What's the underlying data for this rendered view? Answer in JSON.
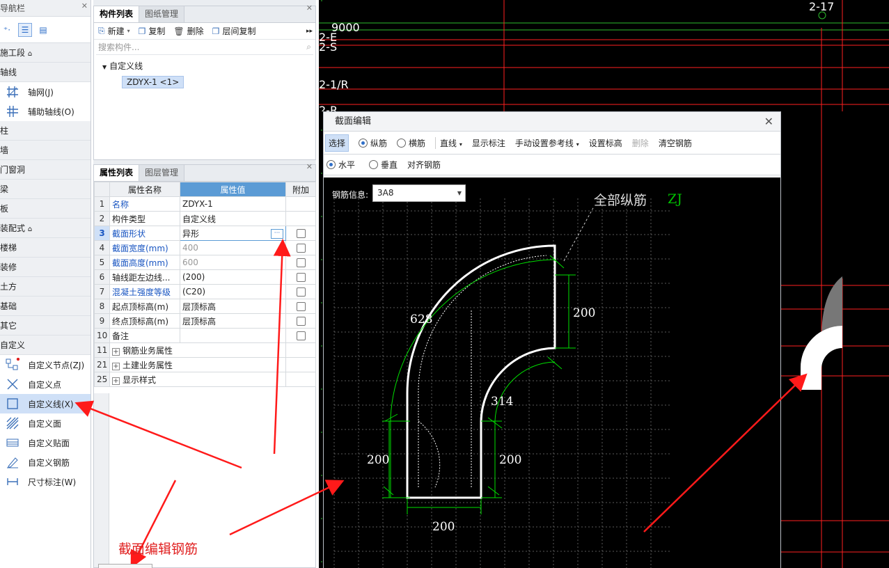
{
  "nav": {
    "title": "导航栏",
    "categories": {
      "c1": "施工段",
      "c2": "轴线",
      "c3": "柱",
      "c4": "墙",
      "c5": "门窗洞",
      "c6": "梁",
      "c7": "板",
      "c8": "装配式",
      "c9": "楼梯",
      "c10": "装修",
      "c11": "土方",
      "c12": "基础",
      "c13": "其它",
      "c14": "自定义"
    },
    "axis_items": {
      "grid": "轴网(J)",
      "aux": "辅助轴线(O)"
    },
    "custom_items": {
      "node": "自定义节点(ZJ)",
      "point": "自定义点",
      "line": "自定义线(X)",
      "face": "自定义面",
      "patch": "自定义贴面",
      "rebar": "自定义钢筋",
      "dim": "尺寸标注(W)"
    }
  },
  "component_panel": {
    "tab1": "构件列表",
    "tab2": "图纸管理",
    "toolbar": {
      "new": "新建",
      "copy": "复制",
      "delete": "删除",
      "floor_copy": "层间复制"
    },
    "search_placeholder": "搜索构件...",
    "tree_root": "自定义线",
    "tree_leaf": "ZDYX-1 <1>"
  },
  "property_panel": {
    "tab1": "属性列表",
    "tab2": "图层管理",
    "headers": {
      "name": "属性名称",
      "value": "属性值",
      "extra": "附加"
    },
    "rows": {
      "r1": {
        "n": "1",
        "name": "名称",
        "value": "ZDYX-1"
      },
      "r2": {
        "n": "2",
        "name": "构件类型",
        "value": "自定义线"
      },
      "r3": {
        "n": "3",
        "name": "截面形状",
        "value": "异形"
      },
      "r4": {
        "n": "4",
        "name": "截面宽度(mm)",
        "value": "400"
      },
      "r5": {
        "n": "5",
        "name": "截面高度(mm)",
        "value": "600"
      },
      "r6": {
        "n": "6",
        "name": "轴线距左边线...",
        "value": "(200)"
      },
      "r7": {
        "n": "7",
        "name": "混凝土强度等级",
        "value": "(C20)"
      },
      "r8": {
        "n": "8",
        "name": "起点顶标高(m)",
        "value": "层顶标高"
      },
      "r9": {
        "n": "9",
        "name": "终点顶标高(m)",
        "value": "层顶标高"
      },
      "r10": {
        "n": "10",
        "name": "备注",
        "value": ""
      },
      "r11": {
        "n": "11",
        "name": "钢筋业务属性"
      },
      "r21": {
        "n": "21",
        "name": "土建业务属性"
      },
      "r25": {
        "n": "25",
        "name": "显示样式"
      }
    }
  },
  "canvas_labels": {
    "top_right": "2-17",
    "dim": "9000",
    "l1": "2-E",
    "l2": "2-S",
    "l3": "2-1/R",
    "l4": "2-R"
  },
  "dialog": {
    "title": "截面编辑",
    "toolbar": {
      "select": "选择",
      "longitudinal": "纵筋",
      "stirrup": "横筋",
      "line": "直线",
      "show_dim": "显示标注",
      "manual_ref": "手动设置参考线",
      "set_elev": "设置标高",
      "delete": "删除",
      "clear": "清空钢筋"
    },
    "toolbar2": {
      "horizontal": "水平",
      "vertical": "垂直",
      "align": "对齐钢筋"
    },
    "rebar_label": "钢筋信息:",
    "rebar_value": "3A8",
    "all_label": "全部纵筋",
    "zj": "ZJ",
    "dims": {
      "d628": "628",
      "d200a": "200",
      "d314": "314",
      "d200l": "200",
      "d200r": "200",
      "d200b": "200"
    }
  },
  "annotation": "截面编辑钢筋",
  "colors": {
    "accent": "#5b9bd5",
    "arrow": "#ff1a1a",
    "dim": "#00ff00",
    "axis": "#ff2020"
  }
}
